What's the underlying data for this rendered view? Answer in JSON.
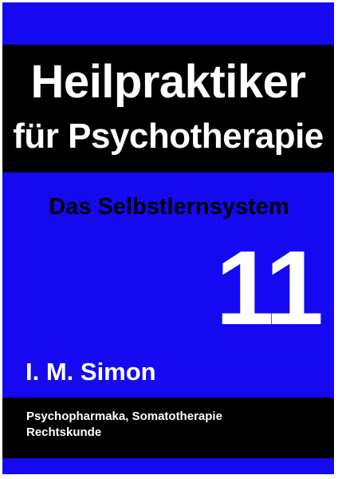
{
  "cover": {
    "title_line_1": "Heilpraktiker",
    "title_line_2": "für Psychotherapie",
    "subtitle": "Das Selbstlernsystem",
    "volume": "11",
    "author": "I. M. Simon",
    "topics_line_1": "Psychopharmaka, Somatotherapie",
    "topics_line_2": "Rechtskunde"
  },
  "colors": {
    "background": "#1509f2",
    "band": "#000000",
    "text_light": "#ffffff",
    "text_dark": "#000000"
  }
}
